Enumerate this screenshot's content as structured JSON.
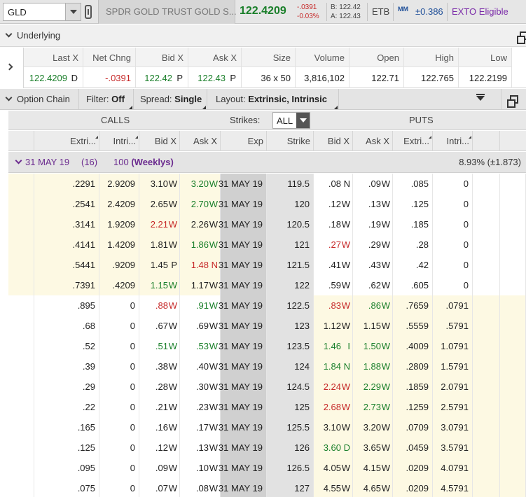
{
  "header": {
    "symbol": "GLD",
    "description": "SPDR GOLD TRUST GOLD S...",
    "last": "122.4209",
    "net_change": "-.0391",
    "pct_change": "-0.03%",
    "bid": "B: 122.42",
    "ask": "A: 122.43",
    "etb": "ETB",
    "mm_label": "MM",
    "mm_value": "±0.386",
    "exto": "EXTO Eligible"
  },
  "underlying": {
    "title": "Underlying",
    "columns": [
      {
        "header": "Last X",
        "value": "122.4209",
        "exch": "D"
      },
      {
        "header": "Net Chng",
        "value": "-.0391",
        "exch": ""
      },
      {
        "header": "Bid X",
        "value": "122.42",
        "exch": "P"
      },
      {
        "header": "Ask X",
        "value": "122.43",
        "exch": "P"
      },
      {
        "header": "Size",
        "value": "36 x 50",
        "exch": ""
      },
      {
        "header": "Volume",
        "value": "3,816,102",
        "exch": ""
      },
      {
        "header": "Open",
        "value": "122.71",
        "exch": ""
      },
      {
        "header": "High",
        "value": "122.765",
        "exch": ""
      },
      {
        "header": "Low",
        "value": "122.2199",
        "exch": ""
      }
    ]
  },
  "chain": {
    "title": "Option Chain",
    "filter_label": "Filter:",
    "filter_value": "Off",
    "spread_label": "Spread:",
    "spread_value": "Single",
    "layout_label": "Layout:",
    "layout_value": "Extrinsic, Intrinsic",
    "calls_label": "CALLS",
    "puts_label": "PUTS",
    "strikes_label": "Strikes:",
    "strikes_value": "ALL",
    "columns": {
      "call_extr": "Extri...",
      "call_intr": "Intri...",
      "call_bid": "Bid X",
      "call_ask": "Ask X",
      "exp": "Exp",
      "strike": "Strike",
      "put_bid": "Bid X",
      "put_ask": "Ask X",
      "put_extr": "Extri...",
      "put_intr": "Intri..."
    },
    "expiration": {
      "date": "31 MAY 19",
      "days": "(16)",
      "multiplier": "100",
      "tag": "(Weeklys)",
      "iv": "8.93% (±1.873)"
    },
    "rows": [
      {
        "c_ex": ".2291",
        "c_in": "2.9209",
        "c_bid": "3.10",
        "c_bx": "W",
        "c_bc": "k",
        "c_ask": "3.20",
        "c_ax": "W",
        "c_ac": "g",
        "exp": "31 MAY 19",
        "strike": "119.5",
        "p_bid": ".08",
        "p_bx": "N",
        "p_bc": "k",
        "p_ask": ".09",
        "p_ax": "W",
        "p_ac": "k",
        "p_ex": ".085",
        "p_in": "0",
        "itm": "call"
      },
      {
        "c_ex": ".2541",
        "c_in": "2.4209",
        "c_bid": "2.65",
        "c_bx": "W",
        "c_bc": "k",
        "c_ask": "2.70",
        "c_ax": "W",
        "c_ac": "g",
        "exp": "31 MAY 19",
        "strike": "120",
        "p_bid": ".12",
        "p_bx": "W",
        "p_bc": "k",
        "p_ask": ".13",
        "p_ax": "W",
        "p_ac": "k",
        "p_ex": ".125",
        "p_in": "0",
        "itm": "call"
      },
      {
        "c_ex": ".3141",
        "c_in": "1.9209",
        "c_bid": "2.21",
        "c_bx": "W",
        "c_bc": "r",
        "c_ask": "2.26",
        "c_ax": "W",
        "c_ac": "k",
        "exp": "31 MAY 19",
        "strike": "120.5",
        "p_bid": ".18",
        "p_bx": "W",
        "p_bc": "k",
        "p_ask": ".19",
        "p_ax": "W",
        "p_ac": "k",
        "p_ex": ".185",
        "p_in": "0",
        "itm": "call"
      },
      {
        "c_ex": ".4141",
        "c_in": "1.4209",
        "c_bid": "1.81",
        "c_bx": "W",
        "c_bc": "k",
        "c_ask": "1.86",
        "c_ax": "W",
        "c_ac": "g",
        "exp": "31 MAY 19",
        "strike": "121",
        "p_bid": ".27",
        "p_bx": "W",
        "p_bc": "r",
        "p_ask": ".29",
        "p_ax": "W",
        "p_ac": "k",
        "p_ex": ".28",
        "p_in": "0",
        "itm": "call"
      },
      {
        "c_ex": ".5441",
        "c_in": ".9209",
        "c_bid": "1.45",
        "c_bx": "P",
        "c_bc": "k",
        "c_ask": "1.48",
        "c_ax": "N",
        "c_ac": "r",
        "exp": "31 MAY 19",
        "strike": "121.5",
        "p_bid": ".41",
        "p_bx": "W",
        "p_bc": "k",
        "p_ask": ".43",
        "p_ax": "W",
        "p_ac": "k",
        "p_ex": ".42",
        "p_in": "0",
        "itm": "call"
      },
      {
        "c_ex": ".7391",
        "c_in": ".4209",
        "c_bid": "1.15",
        "c_bx": "W",
        "c_bc": "g",
        "c_ask": "1.17",
        "c_ax": "W",
        "c_ac": "k",
        "exp": "31 MAY 19",
        "strike": "122",
        "p_bid": ".59",
        "p_bx": "W",
        "p_bc": "k",
        "p_ask": ".62",
        "p_ax": "W",
        "p_ac": "k",
        "p_ex": ".605",
        "p_in": "0",
        "itm": "call"
      },
      {
        "c_ex": ".895",
        "c_in": "0",
        "c_bid": ".88",
        "c_bx": "W",
        "c_bc": "r",
        "c_ask": ".91",
        "c_ax": "W",
        "c_ac": "g",
        "exp": "31 MAY 19",
        "strike": "122.5",
        "p_bid": ".83",
        "p_bx": "W",
        "p_bc": "r",
        "p_ask": ".86",
        "p_ax": "W",
        "p_ac": "g",
        "p_ex": ".7659",
        "p_in": ".0791",
        "itm": "put"
      },
      {
        "c_ex": ".68",
        "c_in": "0",
        "c_bid": ".67",
        "c_bx": "W",
        "c_bc": "k",
        "c_ask": ".69",
        "c_ax": "W",
        "c_ac": "k",
        "exp": "31 MAY 19",
        "strike": "123",
        "p_bid": "1.12",
        "p_bx": "W",
        "p_bc": "k",
        "p_ask": "1.15",
        "p_ax": "W",
        "p_ac": "k",
        "p_ex": ".5559",
        "p_in": ".5791",
        "itm": "put"
      },
      {
        "c_ex": ".52",
        "c_in": "0",
        "c_bid": ".51",
        "c_bx": "W",
        "c_bc": "g",
        "c_ask": ".53",
        "c_ax": "W",
        "c_ac": "g",
        "exp": "31 MAY 19",
        "strike": "123.5",
        "p_bid": "1.46",
        "p_bx": "I",
        "p_bc": "g",
        "p_ask": "1.50",
        "p_ax": "W",
        "p_ac": "g",
        "p_ex": ".4009",
        "p_in": "1.0791",
        "itm": "put"
      },
      {
        "c_ex": ".39",
        "c_in": "0",
        "c_bid": ".38",
        "c_bx": "W",
        "c_bc": "k",
        "c_ask": ".40",
        "c_ax": "W",
        "c_ac": "k",
        "exp": "31 MAY 19",
        "strike": "124",
        "p_bid": "1.84",
        "p_bx": "N",
        "p_bc": "g",
        "p_ask": "1.88",
        "p_ax": "W",
        "p_ac": "g",
        "p_ex": ".2809",
        "p_in": "1.5791",
        "itm": "put"
      },
      {
        "c_ex": ".29",
        "c_in": "0",
        "c_bid": ".28",
        "c_bx": "W",
        "c_bc": "k",
        "c_ask": ".30",
        "c_ax": "W",
        "c_ac": "k",
        "exp": "31 MAY 19",
        "strike": "124.5",
        "p_bid": "2.24",
        "p_bx": "W",
        "p_bc": "r",
        "p_ask": "2.29",
        "p_ax": "W",
        "p_ac": "g",
        "p_ex": ".1859",
        "p_in": "2.0791",
        "itm": "put"
      },
      {
        "c_ex": ".22",
        "c_in": "0",
        "c_bid": ".21",
        "c_bx": "W",
        "c_bc": "k",
        "c_ask": ".23",
        "c_ax": "W",
        "c_ac": "k",
        "exp": "31 MAY 19",
        "strike": "125",
        "p_bid": "2.68",
        "p_bx": "W",
        "p_bc": "r",
        "p_ask": "2.73",
        "p_ax": "W",
        "p_ac": "g",
        "p_ex": ".1259",
        "p_in": "2.5791",
        "itm": "put"
      },
      {
        "c_ex": ".165",
        "c_in": "0",
        "c_bid": ".16",
        "c_bx": "W",
        "c_bc": "k",
        "c_ask": ".17",
        "c_ax": "W",
        "c_ac": "k",
        "exp": "31 MAY 19",
        "strike": "125.5",
        "p_bid": "3.10",
        "p_bx": "W",
        "p_bc": "k",
        "p_ask": "3.20",
        "p_ax": "W",
        "p_ac": "k",
        "p_ex": ".0709",
        "p_in": "3.0791",
        "itm": "put"
      },
      {
        "c_ex": ".125",
        "c_in": "0",
        "c_bid": ".12",
        "c_bx": "W",
        "c_bc": "k",
        "c_ask": ".13",
        "c_ax": "W",
        "c_ac": "k",
        "exp": "31 MAY 19",
        "strike": "126",
        "p_bid": "3.60",
        "p_bx": "D",
        "p_bc": "g",
        "p_ask": "3.65",
        "p_ax": "W",
        "p_ac": "k",
        "p_ex": ".0459",
        "p_in": "3.5791",
        "itm": "put"
      },
      {
        "c_ex": ".095",
        "c_in": "0",
        "c_bid": ".09",
        "c_bx": "W",
        "c_bc": "k",
        "c_ask": ".10",
        "c_ax": "W",
        "c_ac": "k",
        "exp": "31 MAY 19",
        "strike": "126.5",
        "p_bid": "4.05",
        "p_bx": "W",
        "p_bc": "k",
        "p_ask": "4.15",
        "p_ax": "W",
        "p_ac": "k",
        "p_ex": ".0209",
        "p_in": "4.0791",
        "itm": "put"
      },
      {
        "c_ex": ".075",
        "c_in": "0",
        "c_bid": ".07",
        "c_bx": "W",
        "c_bc": "k",
        "c_ask": ".08",
        "c_ax": "W",
        "c_ac": "k",
        "exp": "31 MAY 19",
        "strike": "127",
        "p_bid": "4.55",
        "p_bx": "W",
        "p_bc": "k",
        "p_ask": "4.65",
        "p_ax": "W",
        "p_ac": "k",
        "p_ex": ".0209",
        "p_in": "4.5791",
        "itm": "put"
      }
    ]
  },
  "colors": {
    "positive": "#1a7f2a",
    "negative": "#c62828",
    "itm_background": "#fdf9e3",
    "expiration_text": "#6b2b8f",
    "exto_text": "#7a2aa8"
  },
  "icons": [
    "dropdown-icon",
    "link-icon",
    "mm-icon",
    "chevron-down-icon",
    "chevron-right-icon",
    "popout-icon",
    "collapse-all-icon"
  ]
}
